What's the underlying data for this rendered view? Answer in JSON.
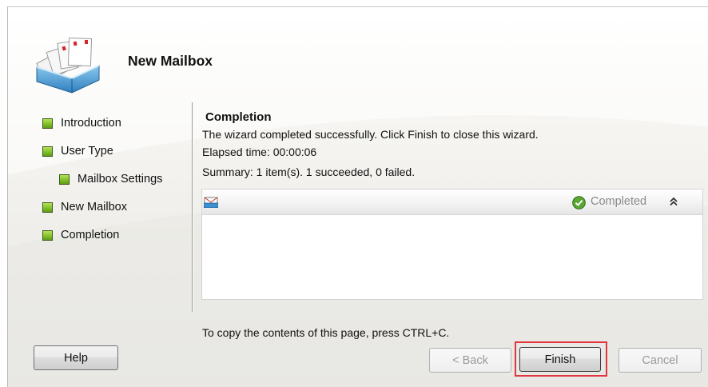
{
  "wizard": {
    "title": "New Mailbox",
    "app_icon": "mailbox-stack-icon"
  },
  "nav": {
    "items": [
      {
        "label": "Introduction",
        "indent": false,
        "status": "complete"
      },
      {
        "label": "User Type",
        "indent": false,
        "status": "complete"
      },
      {
        "label": "Mailbox Settings",
        "indent": true,
        "status": "complete"
      },
      {
        "label": "New Mailbox",
        "indent": false,
        "status": "complete"
      },
      {
        "label": "Completion",
        "indent": false,
        "status": "complete"
      }
    ]
  },
  "content": {
    "heading": "Completion",
    "message": "The wizard completed successfully. Click Finish to close this wizard.",
    "elapsed": "Elapsed time: 00:00:06",
    "summary": "Summary: 1 item(s). 1 succeeded, 0 failed.",
    "copy_hint": "To copy the contents of this page, press CTRL+C."
  },
  "results": {
    "item_icon": "mailbox-icon",
    "status_icon": "green-check-icon",
    "status": "Completed",
    "collapse_icon": "double-chevron-up-icon"
  },
  "buttons": {
    "help": "Help",
    "back": "< Back",
    "finish": "Finish",
    "cancel": "Cancel"
  },
  "colors": {
    "nav_bullet": "#7fbe27",
    "highlight": "#e4343e",
    "status_check": "#4e9a2e"
  }
}
